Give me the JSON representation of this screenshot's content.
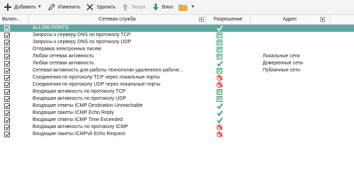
{
  "toolbar": {
    "add_label": "Добавить",
    "edit_label": "Изменить",
    "delete_label": "Удалить",
    "up_label": "Вверх",
    "down_label": "Вниз"
  },
  "columns": {
    "enabled": "Включ...",
    "service": "Сетевая служба",
    "permission": "Разрешение",
    "address": "Адрес"
  },
  "rows": [
    {
      "name": "ALLOW PORTS",
      "permission": "allow",
      "address": "",
      "selected": true
    },
    {
      "name": "Запросы к серверу DNS по протоколу TCP",
      "permission": "ask",
      "address": ""
    },
    {
      "name": "Запросы к серверу DNS по протоколу UDP",
      "permission": "ask",
      "address": ""
    },
    {
      "name": "Отправка электронных писем",
      "permission": "ask",
      "address": ""
    },
    {
      "name": "Любая сетевая активность",
      "permission": "ask",
      "address": "Локальные сети"
    },
    {
      "name": "Любая сетевая активность",
      "permission": "allow",
      "address": "Доверенные сети"
    },
    {
      "name": "Сетевая активность для работы технологии удаленного рабоче...",
      "permission": "ask",
      "address": "Публичные сети"
    },
    {
      "name": "Соединения по протоколу TCP через локальные порты",
      "permission": "block",
      "address": ""
    },
    {
      "name": "Соединения по протоколу UDP через локальные порты",
      "permission": "block",
      "address": ""
    },
    {
      "name": "Входящая активность по протоколу TCP",
      "permission": "ask",
      "address": ""
    },
    {
      "name": "Входящая активность по протоколу UDP",
      "permission": "ask",
      "address": ""
    },
    {
      "name": "Входящие ответы ICMP Destination Unreachable",
      "permission": "allow",
      "address": ""
    },
    {
      "name": "Входящие пакеты ICMP Echo Reply",
      "permission": "allow",
      "address": ""
    },
    {
      "name": "Входящие ответы ICMP Time Exceeded",
      "permission": "allow",
      "address": ""
    },
    {
      "name": "Входящая активность по протоколу ICMP",
      "permission": "block",
      "address": ""
    },
    {
      "name": "Входящие пакеты ICMPv6 Echo Request",
      "permission": "block",
      "address": ""
    }
  ],
  "colors": {
    "selection": "#5fa8a1",
    "allow": "#2e9a6c",
    "block": "#e23a2e"
  }
}
